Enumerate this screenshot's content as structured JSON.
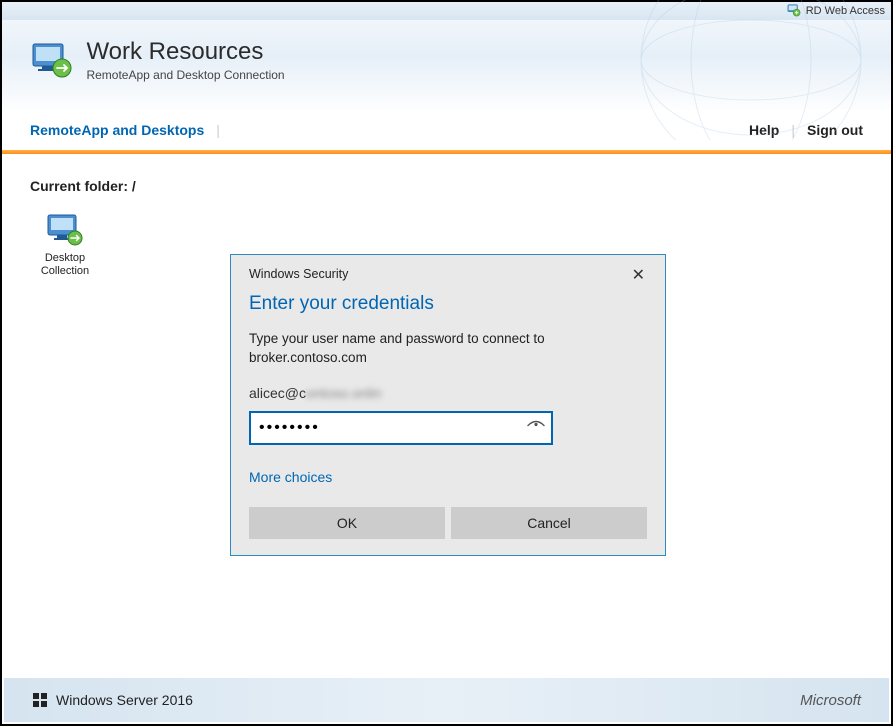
{
  "topbar": {
    "label": "RD Web Access"
  },
  "banner": {
    "title": "Work Resources",
    "subtitle": "RemoteApp and Desktop Connection"
  },
  "nav": {
    "primary": "RemoteApp and Desktops",
    "help": "Help",
    "signout": "Sign out"
  },
  "content": {
    "folder_label": "Current folder: /",
    "app": {
      "label": "Desktop Collection"
    }
  },
  "dialog": {
    "window_title": "Windows Security",
    "heading": "Enter your credentials",
    "message_line1": "Type your user name and password to connect to",
    "message_line2": "broker.contoso.com",
    "username_visible": "alicec@c",
    "username_blurred": "ontoso.onlin",
    "password_value": "••••••••",
    "more_choices": "More choices",
    "ok": "OK",
    "cancel": "Cancel"
  },
  "footer": {
    "product": "Windows Server 2016",
    "company": "Microsoft"
  }
}
